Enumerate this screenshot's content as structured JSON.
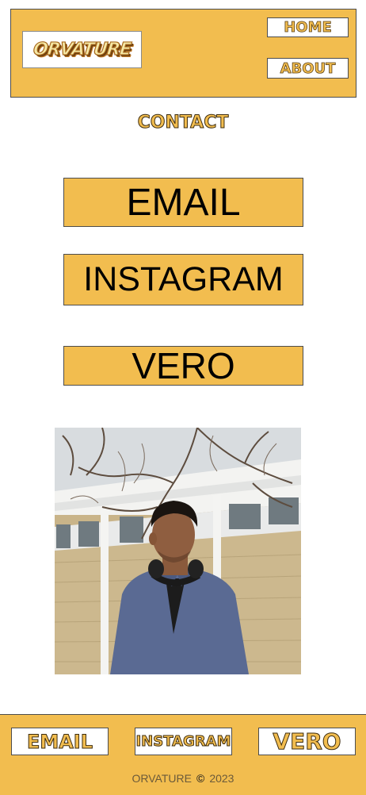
{
  "header": {
    "logo_text": "ORVATURE",
    "nav": {
      "home_label": "HOME",
      "about_label": "ABOUT"
    }
  },
  "main": {
    "section_title": "CONTACT",
    "links": {
      "email_label": "EMAIL",
      "instagram_label": "INSTAGRAM",
      "vero_label": "VERO"
    },
    "photo_icon": "portrait-photo"
  },
  "footer": {
    "links": {
      "email_label": "EMAIL",
      "instagram_label": "INSTAGRAM",
      "vero_label": "VERO"
    },
    "brand": "ORVATURE",
    "copyright_symbol": "©",
    "year": "2023"
  },
  "colors": {
    "accent": "#f2bd4f",
    "border": "#4d4d4d",
    "text": "#000000"
  }
}
